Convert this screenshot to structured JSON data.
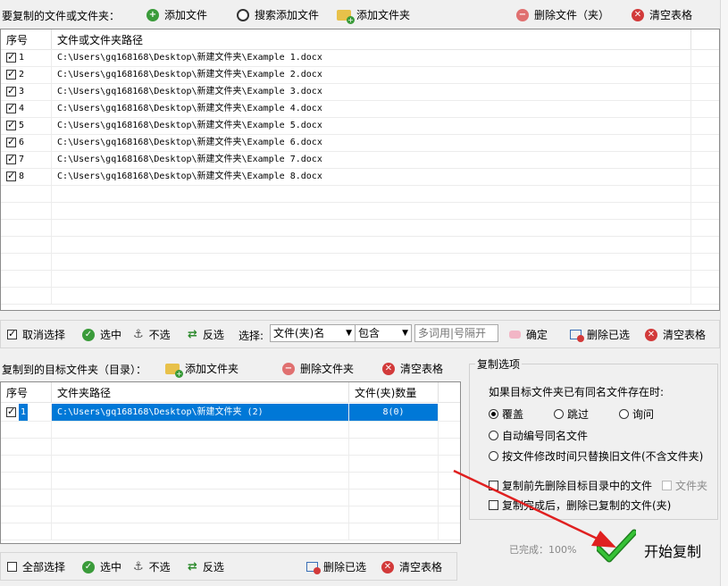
{
  "top_toolbar": {
    "title": "要复制的文件或文件夹：",
    "add_file": "添加文件",
    "search_add_file": "搜索添加文件",
    "add_folder": "添加文件夹",
    "delete_file": "删除文件（夹）",
    "clear_table": "清空表格"
  },
  "file_table": {
    "headers": [
      "序号",
      "文件或文件夹路径"
    ],
    "rows": [
      {
        "no": "1",
        "path": "C:\\Users\\gq168168\\Desktop\\新建文件夹\\Example 1.docx",
        "checked": true
      },
      {
        "no": "2",
        "path": "C:\\Users\\gq168168\\Desktop\\新建文件夹\\Example 2.docx",
        "checked": true
      },
      {
        "no": "3",
        "path": "C:\\Users\\gq168168\\Desktop\\新建文件夹\\Example 3.docx",
        "checked": true
      },
      {
        "no": "4",
        "path": "C:\\Users\\gq168168\\Desktop\\新建文件夹\\Example 4.docx",
        "checked": true
      },
      {
        "no": "5",
        "path": "C:\\Users\\gq168168\\Desktop\\新建文件夹\\Example 5.docx",
        "checked": true
      },
      {
        "no": "6",
        "path": "C:\\Users\\gq168168\\Desktop\\新建文件夹\\Example 6.docx",
        "checked": true
      },
      {
        "no": "7",
        "path": "C:\\Users\\gq168168\\Desktop\\新建文件夹\\Example 7.docx",
        "checked": true
      },
      {
        "no": "8",
        "path": "C:\\Users\\gq168168\\Desktop\\新建文件夹\\Example 8.docx",
        "checked": true
      }
    ]
  },
  "selection_bar": {
    "deselect": "取消选择",
    "select": "选中",
    "unselect": "不选",
    "invert": "反选",
    "choose_label": "选择:",
    "field_select": "文件(夹)名",
    "match_select": "包含",
    "keyword_placeholder": "多词用|号隔开",
    "confirm": "确定",
    "delete_selected": "删除已选",
    "clear_table": "清空表格"
  },
  "target_toolbar": {
    "title": "复制到的目标文件夹（目录）：",
    "add_folder": "添加文件夹",
    "delete_folder": "删除文件夹",
    "clear_table": "清空表格"
  },
  "target_table": {
    "headers": [
      "序号",
      "文件夹路径",
      "文件(夹)数量"
    ],
    "rows": [
      {
        "no": "1",
        "path": "C:\\Users\\gq168168\\Desktop\\新建文件夹 (2)",
        "count": "8(0)",
        "checked": true
      }
    ]
  },
  "bottom_bar": {
    "select_all": "全部选择",
    "select": "选中",
    "unselect": "不选",
    "invert": "反选",
    "delete_selected": "删除已选",
    "clear_table": "清空表格"
  },
  "copy_options": {
    "legend": "复制选项",
    "question": "如果目标文件夹已有同名文件存在时:",
    "overwrite": "覆盖",
    "skip": "跳过",
    "ask": "询问",
    "auto_number": "自动编号同名文件",
    "by_mtime": "按文件修改时间只替换旧文件(不含文件夹)",
    "delete_before": "复制前先删除目标目录中的文件",
    "folder_opt": "文件夹",
    "delete_after": "复制完成后，删除已复制的文件(夹)"
  },
  "status": {
    "progress_text": "已完成：100%",
    "progress": 1.0,
    "start_button": "开始复制"
  },
  "colors": {
    "selection_blue": "#0078d7",
    "annotation_arrow": "#e02020",
    "check_green": "#2e9e2e"
  }
}
